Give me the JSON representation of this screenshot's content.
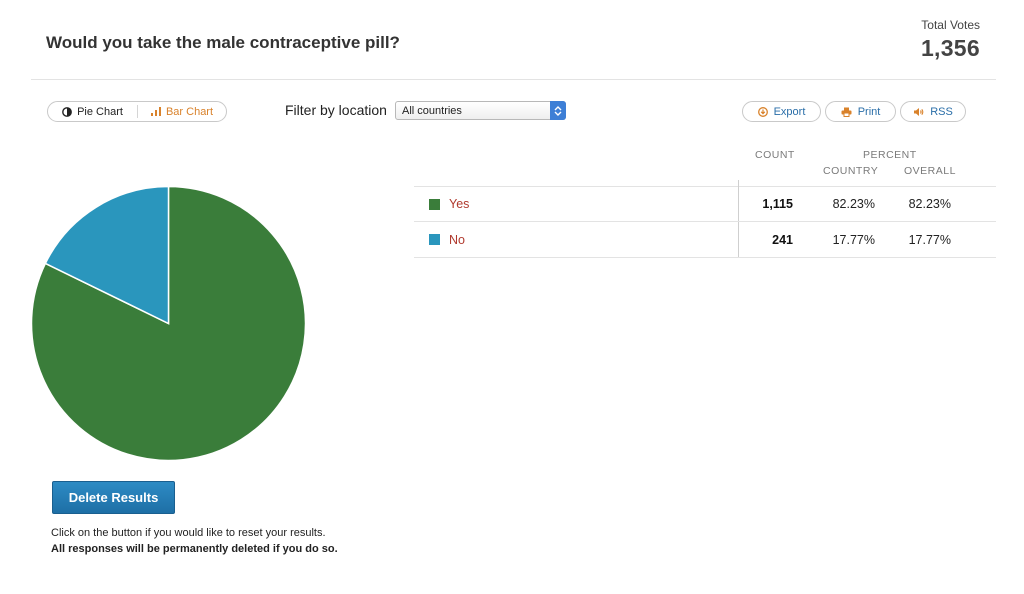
{
  "header": {
    "question": "Would you take the male contraceptive pill?",
    "total_votes_label": "Total Votes",
    "total_votes_value": "1,356"
  },
  "toolbar": {
    "pie_chart_label": "Pie Chart",
    "bar_chart_label": "Bar Chart",
    "active_view": "Pie Chart",
    "filter_label": "Filter by location",
    "filter_selected": "All countries",
    "export_label": "Export",
    "print_label": "Print",
    "rss_label": "RSS"
  },
  "table": {
    "count_header": "COUNT",
    "percent_header": "PERCENT",
    "country_header": "COUNTRY",
    "overall_header": "OVERALL",
    "rows": [
      {
        "label": "Yes",
        "count": "1,115",
        "country": "82.23%",
        "overall": "82.23%",
        "color": "#3a7d3a"
      },
      {
        "label": "No",
        "count": "241",
        "country": "17.77%",
        "overall": "17.77%",
        "color": "#2a96bd"
      }
    ]
  },
  "chart_data": {
    "type": "pie",
    "categories": [
      "Yes",
      "No"
    ],
    "values": [
      1115,
      241
    ],
    "colors": [
      "#3a7d3a",
      "#2a96bd"
    ]
  },
  "actions": {
    "delete_label": "Delete Results",
    "note_line1": "Click on the button if you would like to reset your results.",
    "note_line2": "All responses will be permanently deleted if you do so."
  },
  "colors": {
    "accent_orange": "#d9822b",
    "link_blue": "#2a6ea8",
    "button_blue": "#1e6fa6"
  }
}
